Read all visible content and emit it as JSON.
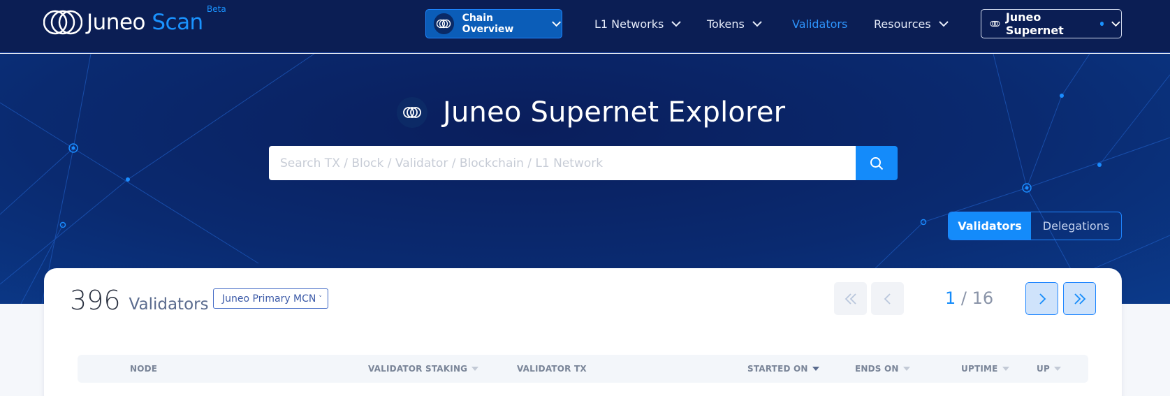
{
  "header": {
    "logo_primary": "Juneo",
    "logo_accent": "Scan",
    "logo_badge": "Beta",
    "chain_button_label": "Chain Overview",
    "nav": [
      {
        "label": "L1 Networks",
        "has_dropdown": true,
        "active": false
      },
      {
        "label": "Tokens",
        "has_dropdown": true,
        "active": false
      },
      {
        "label": "Validators",
        "has_dropdown": false,
        "active": true
      },
      {
        "label": "Resources",
        "has_dropdown": true,
        "active": false
      }
    ],
    "network_button_label": "Juneo Supernet"
  },
  "hero": {
    "title": "Juneo Supernet Explorer",
    "search_placeholder": "Search TX / Block / Validator / Blockchain / L1 Network",
    "toggle": {
      "active": "Validators",
      "inactive": "Delegations"
    }
  },
  "summary": {
    "count": "396",
    "count_label": "Validators",
    "network_select": "Juneo Primary MCN"
  },
  "pagination": {
    "current": "1",
    "separator": "/",
    "total": "16"
  },
  "table": {
    "columns": [
      {
        "label": "NODE",
        "sortable": false
      },
      {
        "label": "VALIDATOR STAKING",
        "sortable": true
      },
      {
        "label": "VALIDATOR TX",
        "sortable": false
      },
      {
        "label": "STARTED ON",
        "sortable": true,
        "sorted": true
      },
      {
        "label": "ENDS ON",
        "sortable": true
      },
      {
        "label": "UPTIME",
        "sortable": true
      },
      {
        "label": "UP",
        "sortable": true
      }
    ]
  },
  "colors": {
    "navy": "#0b1e54",
    "accent": "#148bfa",
    "nav_active": "#2e96ff"
  }
}
